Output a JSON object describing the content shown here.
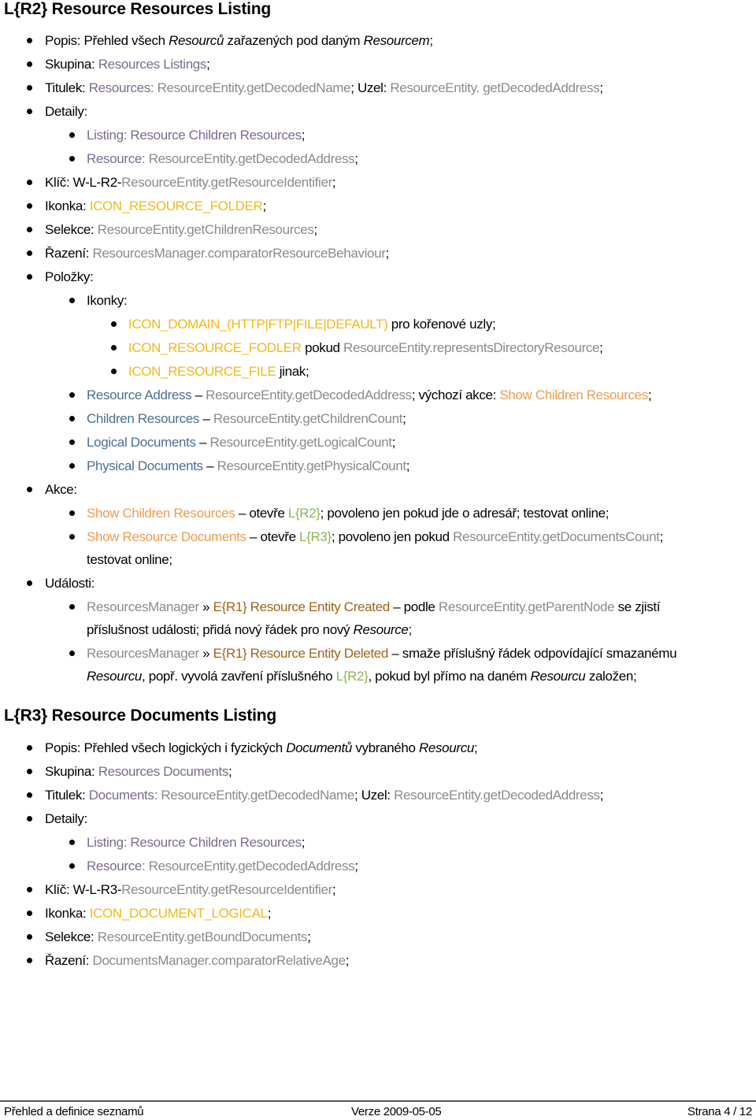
{
  "sections": [
    {
      "heading": "L{R2} Resource Resources Listing",
      "popis_label": "Popis: ",
      "popis_a": "Přehled všech ",
      "popis_b": "Resourců",
      "popis_c": " zařazených pod daným ",
      "popis_d": "Resourcem",
      "popis_e": ";",
      "skupina_label": "Skupina: ",
      "skupina_value": "Resources Listings",
      "titulek_label": "Titulek: ",
      "titulek_prefix": "Resources: ",
      "titulek_value": "ResourceEntity.getDecodedName",
      "uzel_label": "; Uzel: ",
      "uzel_value": "ResourceEntity. getDecodedAddress",
      "detaily_label": "Detaily:",
      "detail_listing": "Listing: Resource Children Resources",
      "detail_resource_label": "Resource: ",
      "detail_resource_value": "ResourceEntity.getDecodedAddress",
      "klic_label": "Klíč: W-L-R2-",
      "klic_value": "ResourceEntity.getResourceIdentifier",
      "ikonka_label": "Ikonka: ",
      "ikonka_value": "ICON_RESOURCE_FOLDER",
      "selekce_label": "Selekce: ",
      "selekce_value": "ResourceEntity.getChildrenResources",
      "razeni_label": "Řazení: ",
      "razeni_value": "ResourcesManager.comparatorResourceBehaviour",
      "polozky_label": "Položky:",
      "ikonky_label": "Ikonky:",
      "icon1": "ICON_DOMAIN_(HTTP|FTP|FILE|DEFAULT)",
      "icon1_text": " pro kořenové uzly;",
      "icon2": "ICON_RESOURCE_FODLER",
      "icon2_text": " pokud ",
      "icon2_method": "ResourceEntity.representsDirectoryResource",
      "icon3": "ICON_RESOURCE_FILE",
      "icon3_text": " jinak;",
      "items": [
        {
          "name": "Resource Address",
          "method": "ResourceEntity.getDecodedAddress",
          "extra": "; výchozí akce: ",
          "action": "Show Children Resources"
        },
        {
          "name": "Children Resources",
          "method": "ResourceEntity.getChildrenCount"
        },
        {
          "name": "Logical Documents",
          "method": "ResourceEntity.getLogicalCount"
        },
        {
          "name": "Physical Documents",
          "method": "ResourceEntity.getPhysicalCount"
        }
      ],
      "akce_label": "Akce:",
      "actions": [
        {
          "name": "Show Children Resources",
          "opens": " – otevře ",
          "target": "L{R2}",
          "text": "; povoleno jen pokud jde o adresář; testovat online;"
        },
        {
          "name": "Show Resource Documents",
          "opens": " – otevře ",
          "target": "L{R3}",
          "text": "; povoleno jen pokud ",
          "method": "ResourceEntity.getDocumentsCount",
          "cont": "testovat online;"
        }
      ],
      "udalosti_label": "Události:",
      "events": [
        {
          "source": "ResourcesManager",
          "sep": " » ",
          "event": "E{R1} Resource Entity Created",
          "text_a": " – podle ",
          "method": "ResourceEntity.getParentNode",
          "text_b": " se zjistí",
          "cont_a": "příslušnost události; přidá nový řádek pro nový ",
          "cont_b": "Resource",
          "cont_c": ";"
        },
        {
          "source": "ResourcesManager",
          "sep": " » ",
          "event": "E{R1} Resource Entity Deleted",
          "text_a": " – smaže příslušný řádek odpovídající smazanému",
          "cont_a": "Resourcu",
          "cont_b": ", popř. vyvolá zavření příslušného ",
          "cont_c": "L{R2}",
          "cont_d": ", pokud byl přímo na daném ",
          "cont_e": "Resourcu",
          "cont_f": " založen;"
        }
      ]
    },
    {
      "heading": "L{R3} Resource Documents Listing",
      "popis_label": "Popis: ",
      "popis_a": "Přehled všech logických i fyzických ",
      "popis_b": "Documentů",
      "popis_c": " vybraného ",
      "popis_d": "Resourcu",
      "popis_e": ";",
      "skupina_label": "Skupina: ",
      "skupina_value": "Resources Documents",
      "titulek_label": "Titulek: ",
      "titulek_prefix": "Documents: ",
      "titulek_value": "ResourceEntity.getDecodedName",
      "uzel_label": "; Uzel: ",
      "uzel_value": "ResourceEntity.getDecodedAddress",
      "detaily_label": "Detaily:",
      "detail_listing": "Listing: Resource Children Resources",
      "detail_resource_label": "Resource: ",
      "detail_resource_value": "ResourceEntity.getDecodedAddress",
      "klic_label": "Klíč: W-L-R3-",
      "klic_value": "ResourceEntity.getResourceIdentifier",
      "ikonka_label": "Ikonka: ",
      "ikonka_value": "ICON_DOCUMENT_LOGICAL",
      "selekce_label": "Selekce: ",
      "selekce_value": "ResourceEntity.getBoundDocuments",
      "razeni_label": "Řazení: ",
      "razeni_value": "DocumentsManager.comparatorRelativeAge"
    }
  ],
  "footer": {
    "left": "Přehled a definice seznamů",
    "center": "Verze 2009-05-05",
    "right": "Strana 4 / 12"
  },
  "colors": {
    "reference": "#7b6b8d",
    "method": "#8a8a8a",
    "icon": "#f2b81a",
    "column": "#4a6f93",
    "action": "#ef9b4f",
    "listing_ref": "#8cb44f",
    "event": "#a0631a"
  }
}
